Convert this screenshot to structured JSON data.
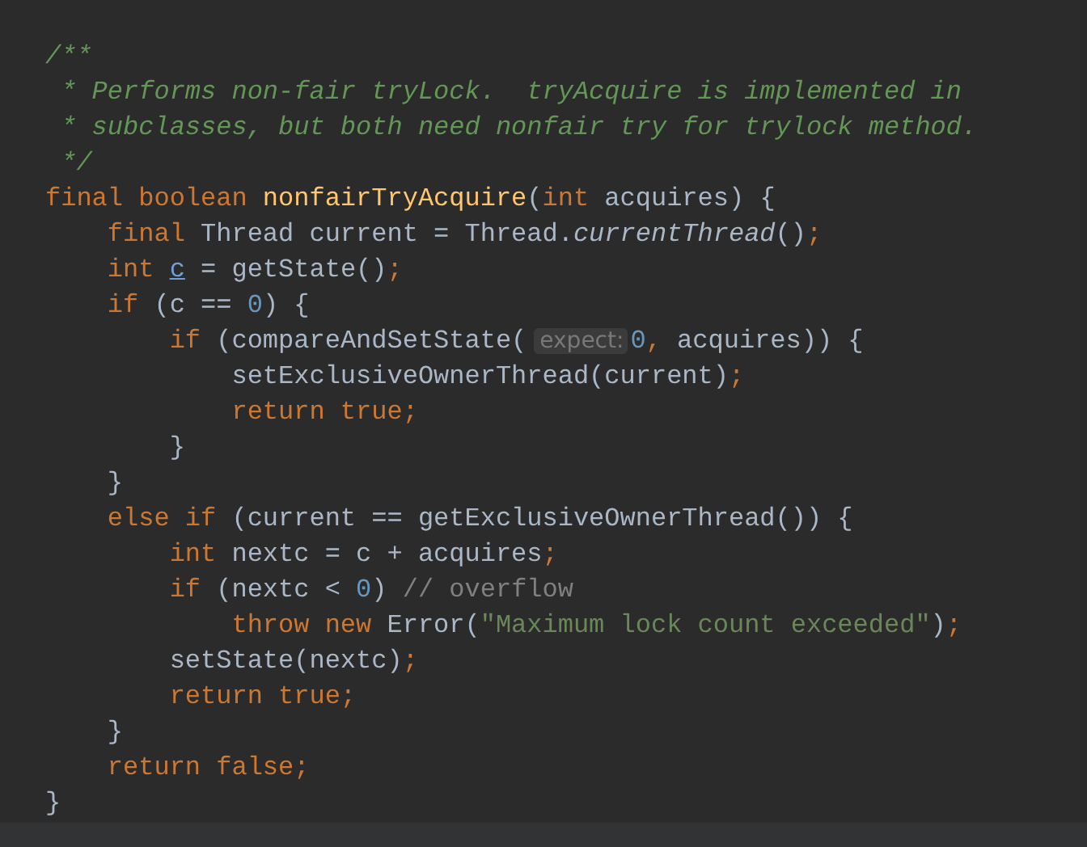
{
  "editor": {
    "lines": [
      [
        {
          "text": "/**",
          "kind": "doc"
        }
      ],
      [
        {
          "text": " * Performs non-fair tryLock.  tryAcquire is implemented in",
          "kind": "doc"
        }
      ],
      [
        {
          "text": " * subclasses, but both need nonfair try for trylock method.",
          "kind": "doc"
        }
      ],
      [
        {
          "text": " */",
          "kind": "doc"
        }
      ],
      [
        {
          "text": "final boolean ",
          "kind": "keyword"
        },
        {
          "text": "nonfairTryAcquire",
          "kind": "decl"
        },
        {
          "text": "(",
          "kind": "plain"
        },
        {
          "text": "int ",
          "kind": "keyword"
        },
        {
          "text": "acquires) {",
          "kind": "plain"
        }
      ],
      [
        {
          "text": "    final ",
          "kind": "keyword"
        },
        {
          "text": "Thread current = Thread.",
          "kind": "plain"
        },
        {
          "text": "currentThread",
          "kind": "static"
        },
        {
          "text": "()",
          "kind": "plain"
        },
        {
          "text": ";",
          "kind": "keyword"
        }
      ],
      [
        {
          "text": "    int ",
          "kind": "keyword"
        },
        {
          "text": "c",
          "kind": "reassigned"
        },
        {
          "text": " = getState()",
          "kind": "plain"
        },
        {
          "text": ";",
          "kind": "keyword"
        }
      ],
      [
        {
          "text": "    if ",
          "kind": "keyword"
        },
        {
          "text": "(c == ",
          "kind": "plain"
        },
        {
          "text": "0",
          "kind": "number"
        },
        {
          "text": ") {",
          "kind": "plain"
        }
      ],
      [
        {
          "text": "        if ",
          "kind": "keyword"
        },
        {
          "text": "(compareAndSetState(",
          "kind": "plain"
        },
        {
          "text": "expect:",
          "kind": "hint"
        },
        {
          "text": "0",
          "kind": "number"
        },
        {
          "text": ", ",
          "kind": "keyword"
        },
        {
          "text": "acquires)) {",
          "kind": "plain"
        }
      ],
      [
        {
          "text": "            setExclusiveOwnerThread(current)",
          "kind": "plain"
        },
        {
          "text": ";",
          "kind": "keyword"
        }
      ],
      [
        {
          "text": "            return true;",
          "kind": "keyword"
        }
      ],
      [
        {
          "text": "        }",
          "kind": "plain"
        }
      ],
      [
        {
          "text": "    }",
          "kind": "plain"
        }
      ],
      [
        {
          "text": "    else if ",
          "kind": "keyword"
        },
        {
          "text": "(current == getExclusiveOwnerThread()) {",
          "kind": "plain"
        }
      ],
      [
        {
          "text": "        int ",
          "kind": "keyword"
        },
        {
          "text": "nextc = c + acquires",
          "kind": "plain"
        },
        {
          "text": ";",
          "kind": "keyword"
        }
      ],
      [
        {
          "text": "        if ",
          "kind": "keyword"
        },
        {
          "text": "(nextc < ",
          "kind": "plain"
        },
        {
          "text": "0",
          "kind": "number"
        },
        {
          "text": ") ",
          "kind": "plain"
        },
        {
          "text": "// overflow",
          "kind": "comment"
        }
      ],
      [
        {
          "text": "            throw new ",
          "kind": "keyword"
        },
        {
          "text": "Error(",
          "kind": "plain"
        },
        {
          "text": "\"Maximum lock count exceeded\"",
          "kind": "string"
        },
        {
          "text": ")",
          "kind": "plain"
        },
        {
          "text": ";",
          "kind": "keyword"
        }
      ],
      [
        {
          "text": "        setState(nextc)",
          "kind": "plain"
        },
        {
          "text": ";",
          "kind": "keyword"
        }
      ],
      [
        {
          "text": "        return true;",
          "kind": "keyword"
        }
      ],
      [
        {
          "text": "    }",
          "kind": "plain"
        }
      ],
      [
        {
          "text": "    return false;",
          "kind": "keyword"
        }
      ],
      [
        {
          "text": "}",
          "kind": "plain"
        }
      ]
    ]
  }
}
